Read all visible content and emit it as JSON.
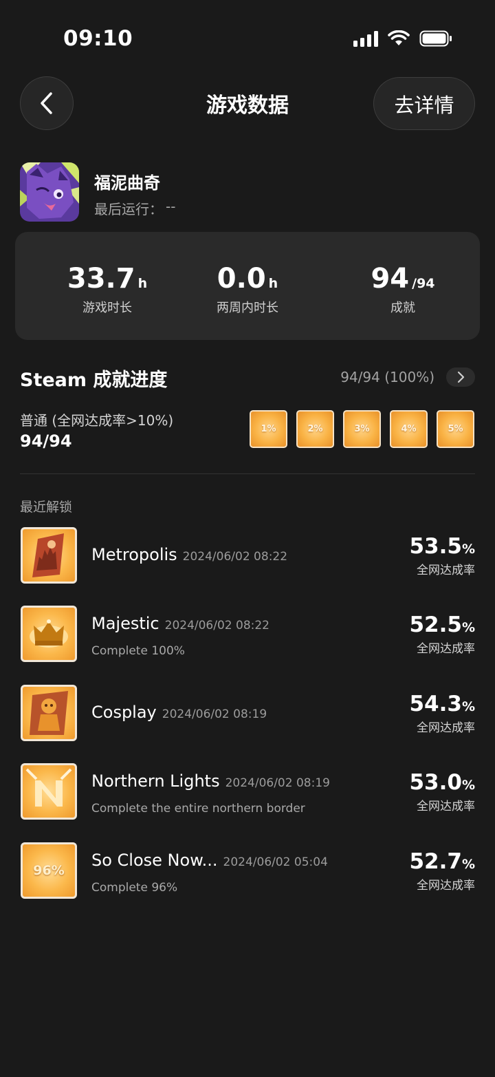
{
  "status_bar": {
    "time": "09:10"
  },
  "header": {
    "title": "游戏数据",
    "detail_button": "去详情"
  },
  "game": {
    "name": "福泥曲奇",
    "last_run_label": "最后运行：",
    "last_run_value": "--"
  },
  "stats": [
    {
      "value": "33.7",
      "unit": "h",
      "label": "游戏时长"
    },
    {
      "value": "0.0",
      "unit": "h",
      "label": "两周内时长"
    },
    {
      "value": "94",
      "unit": "/94",
      "label": "成就"
    }
  ],
  "achievements_progress": {
    "title": "Steam 成就进度",
    "summary": "94/94 (100%)",
    "tier_label": "普通 (全网达成率>10%)",
    "tier_count": "94/94",
    "badges": [
      "1%",
      "2%",
      "3%",
      "4%",
      "5%"
    ]
  },
  "recent": {
    "label": "最近解锁",
    "items": [
      {
        "name": "Metropolis",
        "date": "2024/06/02 08:22",
        "desc": "",
        "rate": "53.5",
        "rate_unit": "%",
        "rate_label": "全网达成率",
        "icon": "city-icon"
      },
      {
        "name": "Majestic",
        "date": "2024/06/02 08:22",
        "desc": "Complete 100%",
        "rate": "52.5",
        "rate_unit": "%",
        "rate_label": "全网达成率",
        "icon": "crown-icon"
      },
      {
        "name": "Cosplay",
        "date": "2024/06/02 08:19",
        "desc": "",
        "rate": "54.3",
        "rate_unit": "%",
        "rate_label": "全网达成率",
        "icon": "character-icon"
      },
      {
        "name": "Northern Lights",
        "date": "2024/06/02 08:19",
        "desc": "Complete the entire northern border",
        "rate": "53.0",
        "rate_unit": "%",
        "rate_label": "全网达成率",
        "icon": "letter-n-icon"
      },
      {
        "name": "So Close Now...",
        "date": "2024/06/02 05:04",
        "desc": "Complete 96%",
        "rate": "52.7",
        "rate_unit": "%",
        "rate_label": "全网达成率",
        "icon": "percent-96-icon",
        "icon_text": "96%"
      }
    ]
  },
  "colors": {
    "background": "#1a1a1a",
    "card": "#2a2a2a",
    "badge_orange": "#f9b244"
  }
}
